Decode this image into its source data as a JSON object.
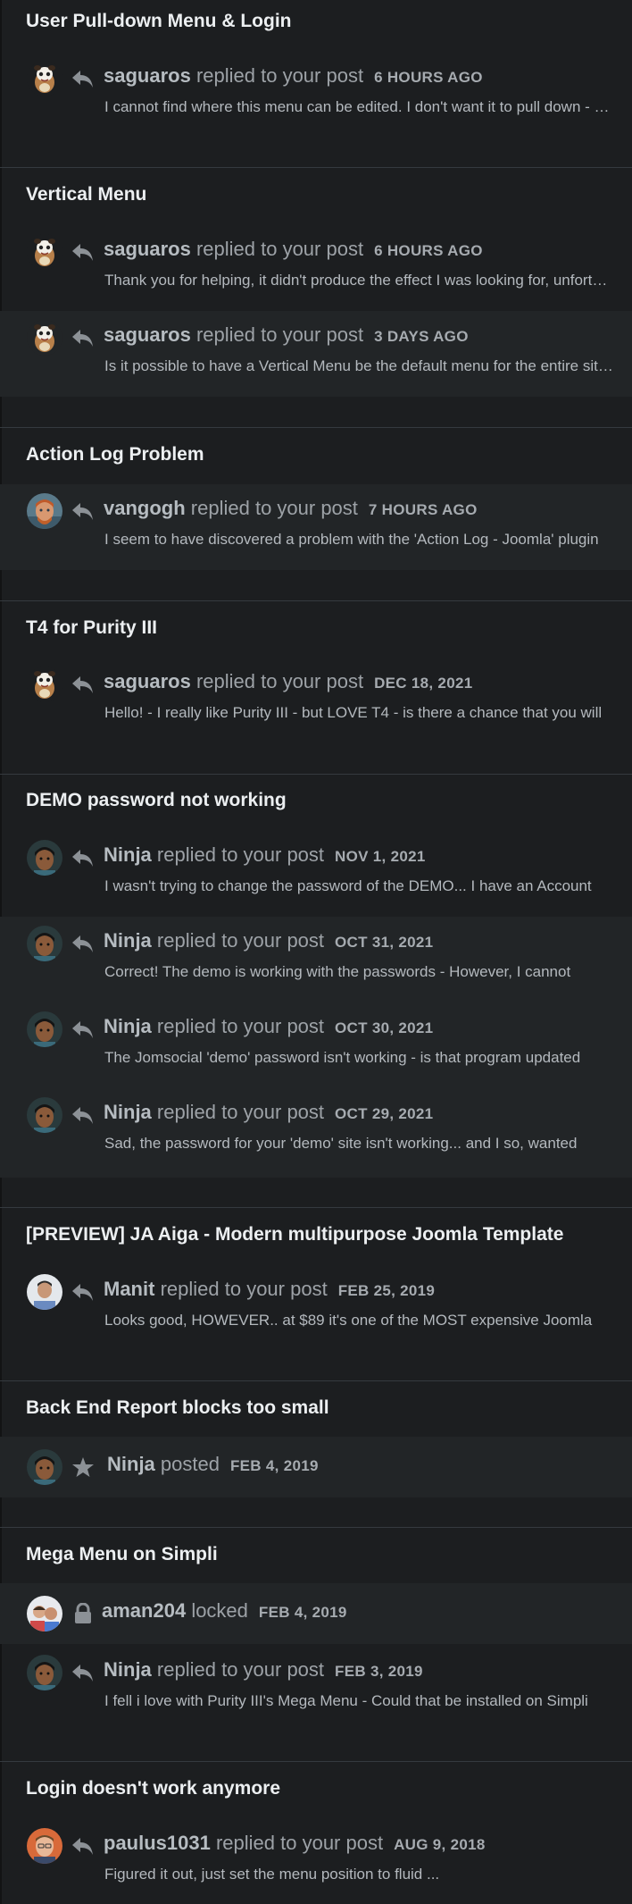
{
  "groups": [
    {
      "title": "User Pull-down Menu & Login",
      "items": [
        {
          "user": "saguaros",
          "verb": "replied to your post",
          "date": "6 HOURS AGO",
          "snippet": "I cannot find where this menu can be edited. I don't want it to pull down - I want it",
          "avatar": "saguaros-avatar",
          "icon": "reply-icon"
        }
      ]
    },
    {
      "title": "Vertical Menu",
      "items": [
        {
          "user": "saguaros",
          "verb": "replied to your post",
          "date": "6 HOURS AGO",
          "snippet": "Thank you for helping, it didn't produce the effect I was looking for, unfortunately",
          "avatar": "saguaros-avatar",
          "icon": "reply-icon"
        },
        {
          "user": "saguaros",
          "verb": "replied to your post",
          "date": "3 DAYS AGO",
          "snippet": "Is it possible to have a Vertical Menu be the default menu for the entire site?",
          "avatar": "saguaros-avatar",
          "icon": "reply-icon"
        }
      ]
    },
    {
      "title": "Action Log Problem",
      "items": [
        {
          "user": "vangogh",
          "verb": "replied to your post",
          "date": "7 HOURS AGO",
          "snippet": "I seem to have discovered a problem with the 'Action Log - Joomla' plugin",
          "avatar": "vangogh-avatar",
          "icon": "reply-icon"
        }
      ]
    },
    {
      "title": "T4 for Purity III",
      "items": [
        {
          "user": "saguaros",
          "verb": "replied to your post",
          "date": "DEC 18, 2021",
          "snippet": "Hello! - I really like Purity III - but LOVE T4 - is there a chance that you will",
          "avatar": "saguaros-avatar",
          "icon": "reply-icon"
        }
      ]
    },
    {
      "title": "DEMO password not working",
      "items": [
        {
          "user": "Ninja",
          "verb": "replied to your post",
          "date": "NOV 1, 2021",
          "snippet": "I wasn't trying to change the password of the DEMO... I have an Account",
          "avatar": "ninja-avatar",
          "icon": "reply-icon"
        },
        {
          "user": "Ninja",
          "verb": "replied to your post",
          "date": "OCT 31, 2021",
          "snippet": "Correct! The demo is working with the passwords - However, I cannot",
          "avatar": "ninja-avatar",
          "icon": "reply-icon"
        },
        {
          "user": "Ninja",
          "verb": "replied to your post",
          "date": "OCT 30, 2021",
          "snippet": "The Jomsocial 'demo' password isn't working - is that program updated",
          "avatar": "ninja-avatar",
          "icon": "reply-icon"
        },
        {
          "user": "Ninja",
          "verb": "replied to your post",
          "date": "OCT 29, 2021",
          "snippet": "Sad, the password for your 'demo' site isn't working... and I so, wanted",
          "avatar": "ninja-avatar",
          "icon": "reply-icon"
        }
      ]
    },
    {
      "title": "[PREVIEW] JA Aiga - Modern multipurpose Joomla Template",
      "items": [
        {
          "user": "Manit",
          "verb": "replied to your post",
          "date": "FEB 25, 2019",
          "snippet": "Looks good, HOWEVER.. at $89 it's one of the MOST expensive Joomla",
          "avatar": "manit-avatar",
          "icon": "reply-icon"
        }
      ]
    },
    {
      "title": "Back End Report blocks too small",
      "items": [
        {
          "user": "Ninja",
          "verb": "posted",
          "date": "FEB 4, 2019",
          "snippet": "",
          "avatar": "ninja-avatar",
          "icon": "star-icon"
        }
      ]
    },
    {
      "title": "Mega Menu on Simpli",
      "items": [
        {
          "user": "aman204",
          "verb": "locked",
          "date": "FEB 4, 2019",
          "snippet": "",
          "avatar": "aman204-avatar",
          "icon": "lock-icon"
        },
        {
          "user": "Ninja",
          "verb": "replied to your post",
          "date": "FEB 3, 2019",
          "snippet": "I fell i love with Purity III's Mega Menu - Could that be installed on Simpli",
          "avatar": "ninja-avatar",
          "icon": "reply-icon"
        }
      ]
    },
    {
      "title": "Login doesn't work anymore",
      "items": [
        {
          "user": "paulus1031",
          "verb": "replied to your post",
          "date": "AUG 9, 2018",
          "snippet": "Figured it out, just set the menu position to fluid ...",
          "avatar": "paulus-avatar",
          "icon": "reply-icon"
        }
      ]
    }
  ]
}
